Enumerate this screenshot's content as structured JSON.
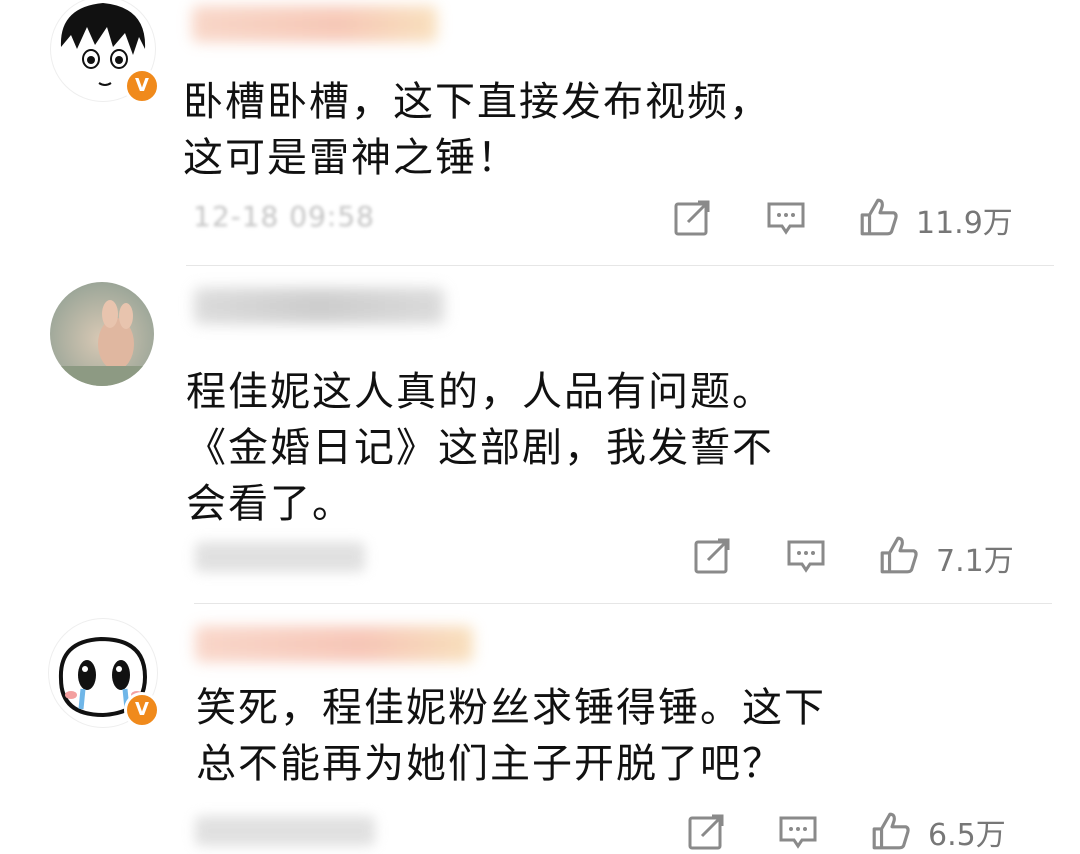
{
  "comments": [
    {
      "text": "卧槽卧槽，这下直接发布视频，\n这可是雷神之锤！",
      "time": "12-18 09:58",
      "likes": "11.9万",
      "verified_badge": "V",
      "avatar_icon": "anime-boy-avatar"
    },
    {
      "text": "程佳妮这人真的，人品有问题。\n《金婚日记》这部剧，我发誓不\n会看了。",
      "likes": "7.1万",
      "avatar_icon": "plush-toy-avatar"
    },
    {
      "text": "笑死，程佳妮粉丝求锤得锤。这下\n总不能再为她们主子开脱了吧？",
      "likes": "6.5万",
      "verified_badge": "V",
      "avatar_icon": "crying-face-avatar"
    }
  ],
  "colors": {
    "badge": "#f08a1c",
    "icon": "#8a8a8a",
    "divider": "#e6e6e6"
  }
}
